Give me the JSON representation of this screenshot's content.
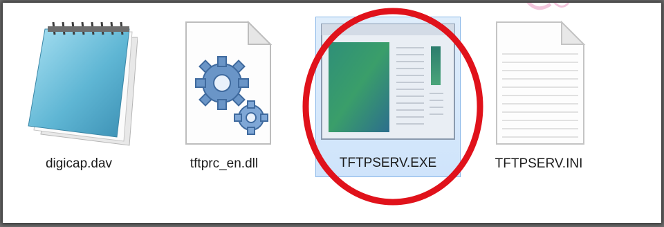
{
  "files": [
    {
      "name": "digicap.dav",
      "icon": "notepad-icon"
    },
    {
      "name": "tftprc_en.dll",
      "icon": "dll-gears-icon"
    },
    {
      "name": "TFTPSERV.EXE",
      "icon": "exe-window-icon",
      "selected": true
    },
    {
      "name": "TFTPSERV.INI",
      "icon": "ini-text-file-icon"
    }
  ],
  "highlight": {
    "shape": "circle",
    "color": "#e0121b",
    "target": "TFTPSERV.EXE"
  },
  "selection_color": "#cfe4fb"
}
